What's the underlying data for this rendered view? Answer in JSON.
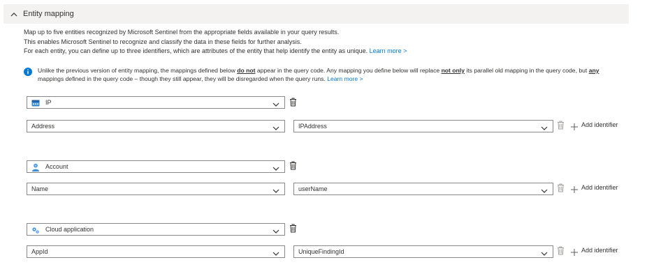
{
  "section": {
    "title": "Entity mapping"
  },
  "description": {
    "line1": "Map up to five entities recognized by Microsoft Sentinel from the appropriate fields available in your query results.",
    "line2": "This enables Microsoft Sentinel to recognize and classify the data in these fields for further analysis.",
    "line3": "For each entity, you can define up to three identifiers, which are attributes of the entity that help identify the entity as unique.",
    "learn_more": "Learn more >"
  },
  "info": {
    "t1": "Unlike the previous version of entity mapping, the mappings defined below ",
    "b1": "do not",
    "t2": " appear in the query code. Any mapping you define below will replace ",
    "b2": "not only",
    "t3": " its parallel old mapping in the query code, but ",
    "b3": "any",
    "t4": " mappings defined in the query code – though they still appear, they will be disregarded when the query runs. ",
    "learn_more": "Learn more >"
  },
  "entities": [
    {
      "type": "IP",
      "icon": "ip-icon",
      "identifier": "Address",
      "column": "IPAddress"
    },
    {
      "type": "Account",
      "icon": "account-icon",
      "identifier": "Name",
      "column": "userName"
    },
    {
      "type": "Cloud application",
      "icon": "cloud-application-icon",
      "identifier": "AppId",
      "column": "UniqueFindingId"
    }
  ],
  "add_identifier_label": "Add identifier",
  "colors": {
    "accent": "#0078d4",
    "border": "#8a8886",
    "header_bg": "#f3f2f1"
  }
}
